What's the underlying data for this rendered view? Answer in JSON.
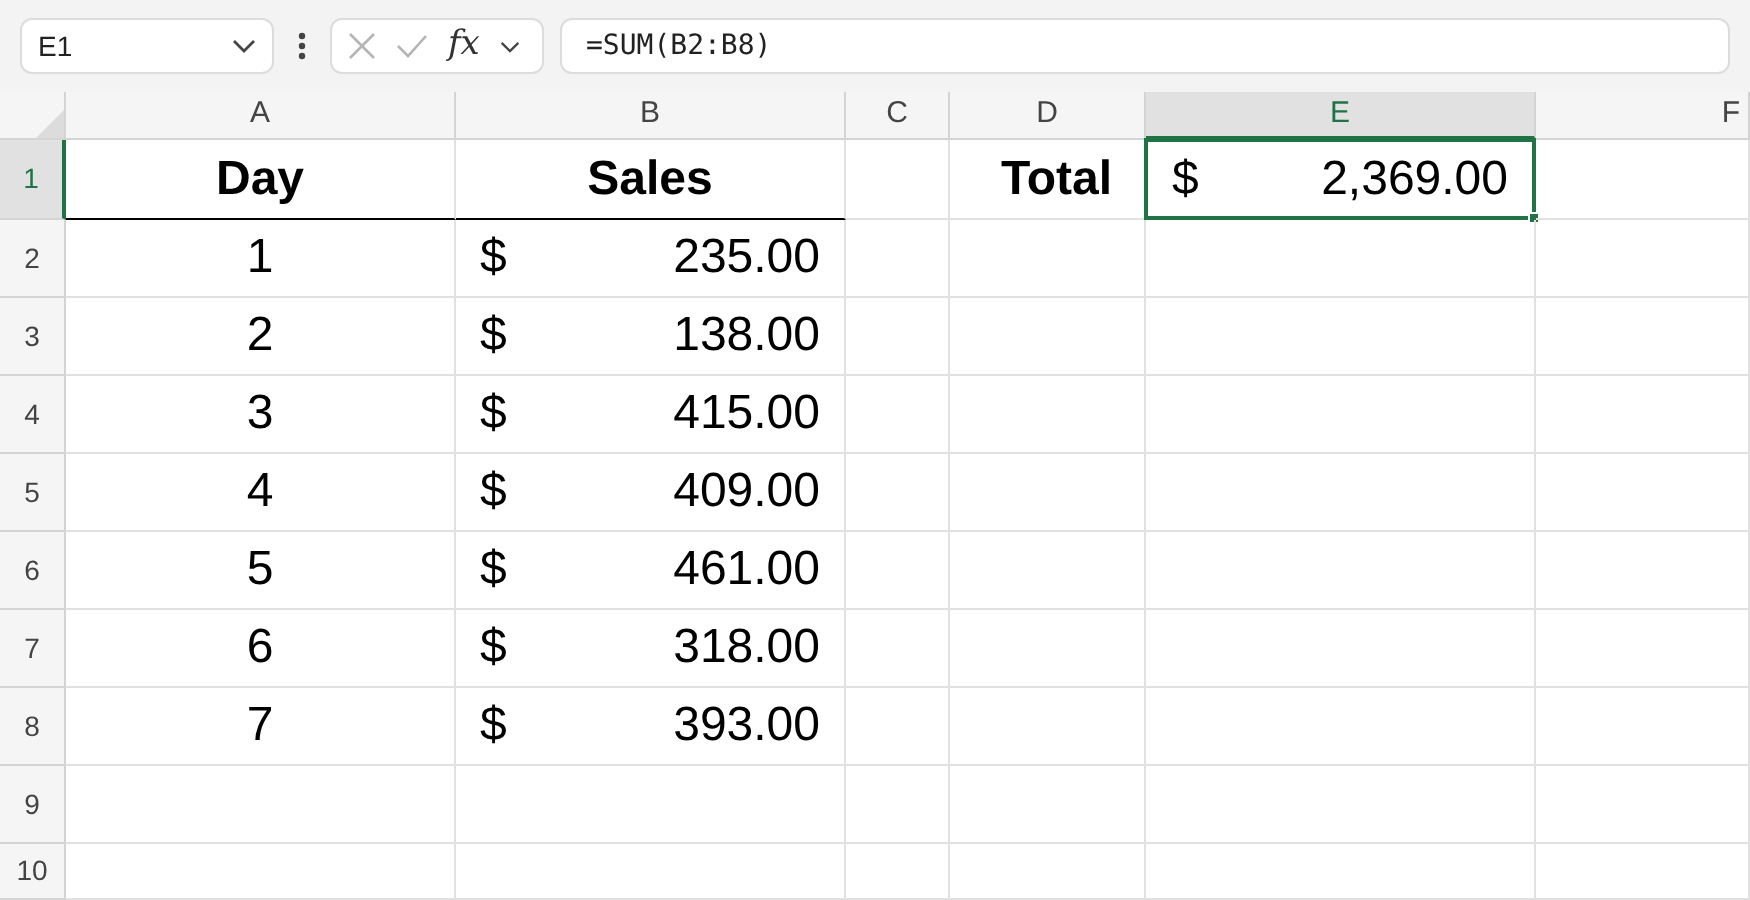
{
  "name_box": {
    "value": "E1"
  },
  "formula_bar": {
    "function_label": "fx",
    "value": "=SUM(B2:B8)"
  },
  "columns": [
    {
      "label": "A",
      "selected": false
    },
    {
      "label": "B",
      "selected": false
    },
    {
      "label": "C",
      "selected": false
    },
    {
      "label": "D",
      "selected": false
    },
    {
      "label": "E",
      "selected": true
    },
    {
      "label": "F",
      "selected": false
    }
  ],
  "rows": [
    {
      "label": "1",
      "selected": true,
      "cells": [
        {
          "kind": "header",
          "text": "Day"
        },
        {
          "kind": "header",
          "text": "Sales"
        },
        null,
        {
          "kind": "label",
          "text": "Total"
        },
        {
          "kind": "currency",
          "symbol": "$",
          "amount": "2,369.00",
          "active": true
        },
        null
      ]
    },
    {
      "label": "2",
      "selected": false,
      "cells": [
        {
          "kind": "number",
          "text": "1"
        },
        {
          "kind": "currency",
          "symbol": "$",
          "amount": "235.00",
          "active": false
        }
      ]
    },
    {
      "label": "3",
      "selected": false,
      "cells": [
        {
          "kind": "number",
          "text": "2"
        },
        {
          "kind": "currency",
          "symbol": "$",
          "amount": "138.00",
          "active": false
        }
      ]
    },
    {
      "label": "4",
      "selected": false,
      "cells": [
        {
          "kind": "number",
          "text": "3"
        },
        {
          "kind": "currency",
          "symbol": "$",
          "amount": "415.00",
          "active": false
        }
      ]
    },
    {
      "label": "5",
      "selected": false,
      "cells": [
        {
          "kind": "number",
          "text": "4"
        },
        {
          "kind": "currency",
          "symbol": "$",
          "amount": "409.00",
          "active": false
        }
      ]
    },
    {
      "label": "6",
      "selected": false,
      "cells": [
        {
          "kind": "number",
          "text": "5"
        },
        {
          "kind": "currency",
          "symbol": "$",
          "amount": "461.00",
          "active": false
        }
      ]
    },
    {
      "label": "7",
      "selected": false,
      "cells": [
        {
          "kind": "number",
          "text": "6"
        },
        {
          "kind": "currency",
          "symbol": "$",
          "amount": "318.00",
          "active": false
        }
      ]
    },
    {
      "label": "8",
      "selected": false,
      "cells": [
        {
          "kind": "number",
          "text": "7"
        },
        {
          "kind": "currency",
          "symbol": "$",
          "amount": "393.00",
          "active": false
        }
      ]
    },
    {
      "label": "9",
      "selected": false,
      "cells": []
    },
    {
      "label": "10",
      "selected": false,
      "cells": []
    }
  ]
}
